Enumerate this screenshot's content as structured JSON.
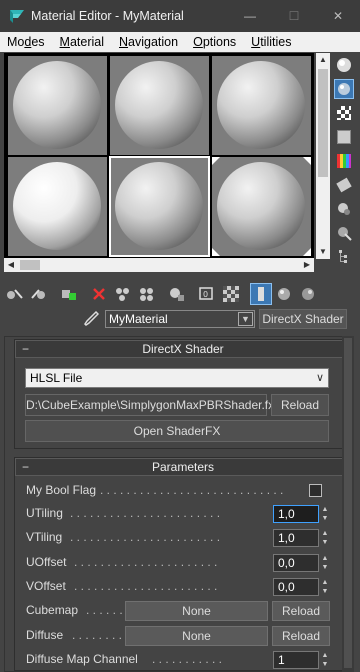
{
  "window": {
    "title": "Material Editor - MyMaterial",
    "minimize_label": "—",
    "maximize_label": "☐",
    "close_label": "✕"
  },
  "menu": {
    "items": [
      {
        "label_u": "Mo",
        "label_rest": "des",
        "hotkey_pos": "underline-d"
      },
      {
        "label_u": "M",
        "label_rest": "aterial"
      },
      {
        "label_u": "N",
        "label_rest": "avigation"
      },
      {
        "label_u": "O",
        "label_rest": "ptions"
      },
      {
        "label_u": "U",
        "label_rest": "tilities"
      }
    ],
    "labels": [
      "Modes",
      "Material",
      "Navigation",
      "Options",
      "Utilities"
    ]
  },
  "material": {
    "name": "MyMaterial",
    "type_button": "DirectX Shader"
  },
  "directx_panel": {
    "title": "DirectX Shader",
    "collapse_label": "−",
    "file_type": "HLSL File",
    "shader_path": "D:\\CubeExample\\SimplygonMaxPBRShader.fx",
    "reload_label": "Reload",
    "open_shaderfx_label": "Open ShaderFX"
  },
  "parameters_panel": {
    "title": "Parameters",
    "collapse_label": "−",
    "params": {
      "my_bool_flag": {
        "label": "My Bool Flag",
        "dots": ". . . . . . . . . . . . . . . . . . . . . . . . . . . .",
        "checked": false
      },
      "utiling": {
        "label": "UTiling",
        "dots": ". . . . . . . . . . . . . . . . . . . . . . .",
        "value": "1,0"
      },
      "vtiling": {
        "label": "VTiling",
        "dots": ". . . . . . . . . . . . . . . . . . . . . . .",
        "value": "1,0"
      },
      "uoffset": {
        "label": "UOffset",
        "dots": ". . . . . . . . . . . . . . . . . . . . . .",
        "value": "0,0"
      },
      "voffset": {
        "label": "VOffset",
        "dots": ". . . . . . . . . . . . . . . . . . . . . .",
        "value": "0,0"
      },
      "cubemap": {
        "label": "Cubemap",
        "dots": ". . . . . . .",
        "map": "None",
        "reload": "Reload"
      },
      "diffuse": {
        "label": "Diffuse",
        "dots": ". . . . . . . .",
        "map": "None",
        "reload": "Reload"
      },
      "diffuse_map_channel": {
        "label": "Diffuse Map Channel",
        "dots": ". . . . . . . . . . .",
        "value": "1"
      }
    }
  },
  "colors": {
    "active_blue": "#3c78b4",
    "focus_blue": "#3fa1ff",
    "slot_bg": "#7d7d7d"
  }
}
